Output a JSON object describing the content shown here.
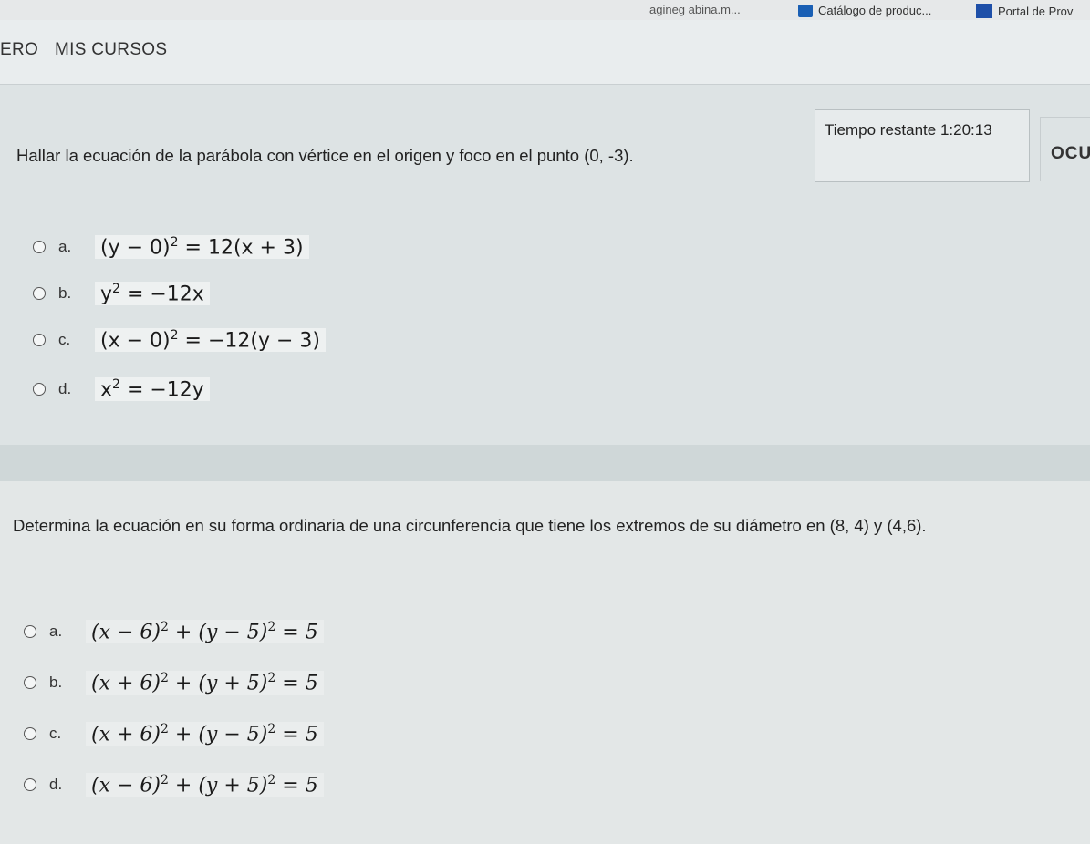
{
  "bookmarks": {
    "partial": "agineg abina.m...",
    "catalogo": "Catálogo de produc...",
    "portal": "Portal de Prov"
  },
  "nav": {
    "left_partial": "ERO",
    "mis_cursos": "MIS CURSOS"
  },
  "timer": {
    "label": "Tiempo restante",
    "value": "1:20:13"
  },
  "side_label": "OCU",
  "question1": {
    "text": "Hallar la ecuación de la parábola con vértice en el origen y foco en el punto (0, -3).",
    "options": [
      {
        "letter": "a.",
        "base1": "(y − 0)",
        "exp1": "2",
        "rest1": " = 12(x + 3)"
      },
      {
        "letter": "b.",
        "base1": "y",
        "exp1": "2",
        "rest1": " = −12x"
      },
      {
        "letter": "c.",
        "base1": "(x − 0)",
        "exp1": "2",
        "rest1": " = −12(y − 3)"
      },
      {
        "letter": "d.",
        "base1": "x",
        "exp1": "2",
        "rest1": " = −12y"
      }
    ]
  },
  "question2": {
    "text": "Determina la ecuación en su forma ordinaria de una circunferencia que tiene los extremos de su diámetro en (8, 4) y (4,6).",
    "options": [
      {
        "letter": "a.",
        "b1": "(x − 6)",
        "e1": "2",
        "b2": " + (y − 5)",
        "e2": "2",
        "rest": " = 5"
      },
      {
        "letter": "b.",
        "b1": "(x + 6)",
        "e1": "2",
        "b2": " + (y + 5)",
        "e2": "2",
        "rest": " = 5"
      },
      {
        "letter": "c.",
        "b1": "(x + 6)",
        "e1": "2",
        "b2": " + (y − 5)",
        "e2": "2",
        "rest": " = 5"
      },
      {
        "letter": "d.",
        "b1": "(x − 6)",
        "e1": "2",
        "b2": " + (y + 5)",
        "e2": "2",
        "rest": " = 5"
      }
    ]
  }
}
